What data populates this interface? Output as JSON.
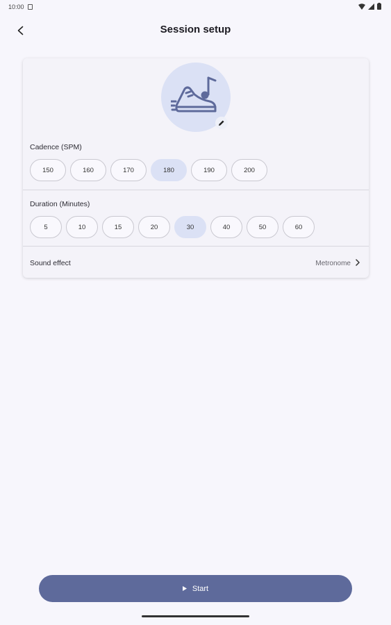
{
  "status_bar": {
    "time": "10:00"
  },
  "header": {
    "title": "Session setup"
  },
  "icons": {
    "back": "back-arrow-icon",
    "avatar": "running-shoe-music-icon",
    "edit": "pencil-icon",
    "chevron": "chevron-right-icon",
    "play": "play-icon"
  },
  "colors": {
    "background": "#f7f6fc",
    "card": "#f4f3f9",
    "selected_chip": "#dbe1f5",
    "primary_button": "#5e6a9b"
  },
  "cadence": {
    "label": "Cadence (SPM)",
    "options": [
      "150",
      "160",
      "170",
      "180",
      "190",
      "200"
    ],
    "selected": "180"
  },
  "duration": {
    "label": "Duration (Minutes)",
    "options": [
      "5",
      "10",
      "15",
      "20",
      "30",
      "40",
      "50",
      "60"
    ],
    "selected": "30"
  },
  "sound": {
    "label": "Sound effect",
    "value": "Metronome"
  },
  "start_button": {
    "label": "Start"
  }
}
